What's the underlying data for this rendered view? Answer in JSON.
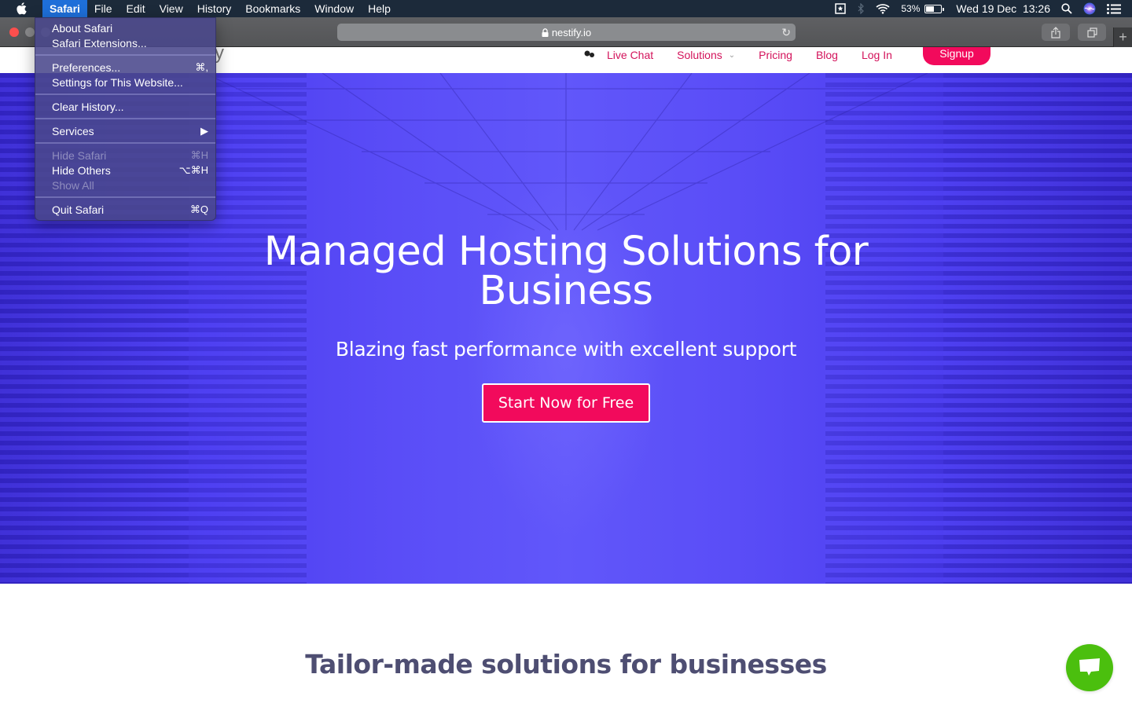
{
  "menubar": {
    "app_menu": "Safari",
    "items": [
      "File",
      "Edit",
      "View",
      "History",
      "Bookmarks",
      "Window",
      "Help"
    ],
    "battery_percent_label": "53%",
    "battery_level": 0.53,
    "clock": "Wed 19 Dec  13:26"
  },
  "browser": {
    "url": "nestify.io"
  },
  "safari_menu": {
    "groups": [
      [
        {
          "label": "About Safari",
          "shortcut": "",
          "enabled": true
        },
        {
          "label": "Safari Extensions...",
          "shortcut": "",
          "enabled": true
        }
      ],
      [
        {
          "label": "Preferences...",
          "shortcut": "⌘,",
          "enabled": true
        },
        {
          "label": "Settings for This Website...",
          "shortcut": "",
          "enabled": true
        }
      ],
      [
        {
          "label": "Clear History...",
          "shortcut": "",
          "enabled": true
        }
      ],
      [
        {
          "label": "Services",
          "shortcut": "▶",
          "enabled": true
        }
      ],
      [
        {
          "label": "Hide Safari",
          "shortcut": "⌘H",
          "enabled": false
        },
        {
          "label": "Hide Others",
          "shortcut": "⌥⌘H",
          "enabled": true
        },
        {
          "label": "Show All",
          "shortcut": "",
          "enabled": false
        }
      ],
      [
        {
          "label": "Quit Safari",
          "shortcut": "⌘Q",
          "enabled": true
        }
      ]
    ]
  },
  "site": {
    "logo_fragment": "y",
    "nav": {
      "live_chat": "Live Chat",
      "solutions": "Solutions",
      "pricing": "Pricing",
      "blog": "Blog",
      "login": "Log In",
      "signup": "Signup"
    },
    "hero": {
      "title_line1": "Managed Hosting Solutions for",
      "title_line2": "Business",
      "subtitle": "Blazing fast performance with excellent support",
      "cta": "Start Now for Free"
    },
    "section_title": "Tailor-made solutions for businesses"
  },
  "colors": {
    "brand_pink": "#f20a5c",
    "hero_blue": "#5a4df7",
    "chat_green": "#4bbf0e",
    "menubar_bg": "#1c2a3a",
    "menu_highlight": "#1e6fd9"
  }
}
